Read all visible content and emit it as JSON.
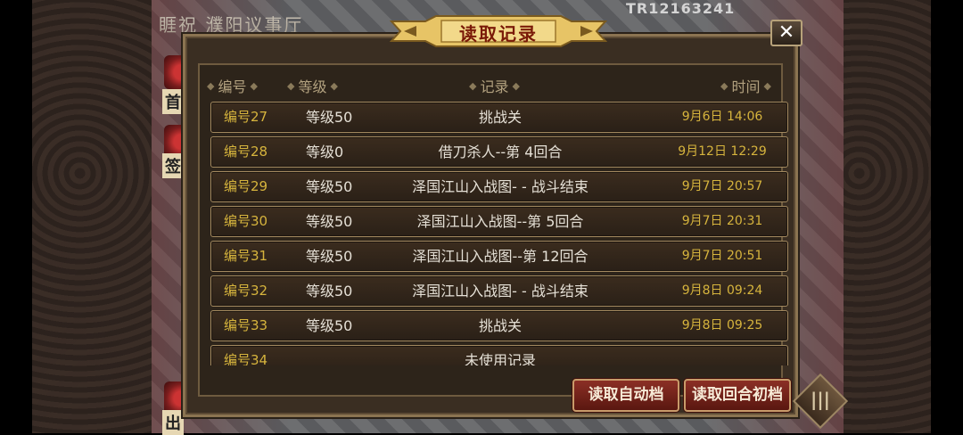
{
  "scene": {
    "title": "睚祝 濮阳议事厅",
    "code": "TR12163241",
    "side_labels": [
      "首充",
      "签到",
      "出"
    ]
  },
  "dialog": {
    "title": "读取记录",
    "close_label": "✕",
    "headers": {
      "no": "编号",
      "level": "等级",
      "record": "记录",
      "time": "时间"
    },
    "rows": [
      {
        "no": "编号27",
        "level": "等级50",
        "record": "挑战关",
        "time": "9月6日 14:06"
      },
      {
        "no": "编号28",
        "level": "等级0",
        "record": "借刀杀人--第 4回合",
        "time": "9月12日 12:29"
      },
      {
        "no": "编号29",
        "level": "等级50",
        "record": "泽国江山入战图- - 战斗结束",
        "time": "9月7日 20:57"
      },
      {
        "no": "编号30",
        "level": "等级50",
        "record": "泽国江山入战图--第 5回合",
        "time": "9月7日 20:31"
      },
      {
        "no": "编号31",
        "level": "等级50",
        "record": "泽国江山入战图--第 12回合",
        "time": "9月7日 20:51"
      },
      {
        "no": "编号32",
        "level": "等级50",
        "record": "泽国江山入战图- - 战斗结束",
        "time": "9月8日 09:24"
      },
      {
        "no": "编号33",
        "level": "等级50",
        "record": "挑战关",
        "time": "9月8日 09:25"
      },
      {
        "no": "编号34",
        "level": "",
        "record": "未使用记录",
        "time": ""
      }
    ],
    "buttons": {
      "auto_save": "读取自动档",
      "round_start": "读取回合初档"
    },
    "menu_icon": "menu-lines-icon"
  },
  "colors": {
    "accent_gold": "#d6b43d",
    "button_red": "#8b2f25",
    "panel": "#2d241a"
  }
}
